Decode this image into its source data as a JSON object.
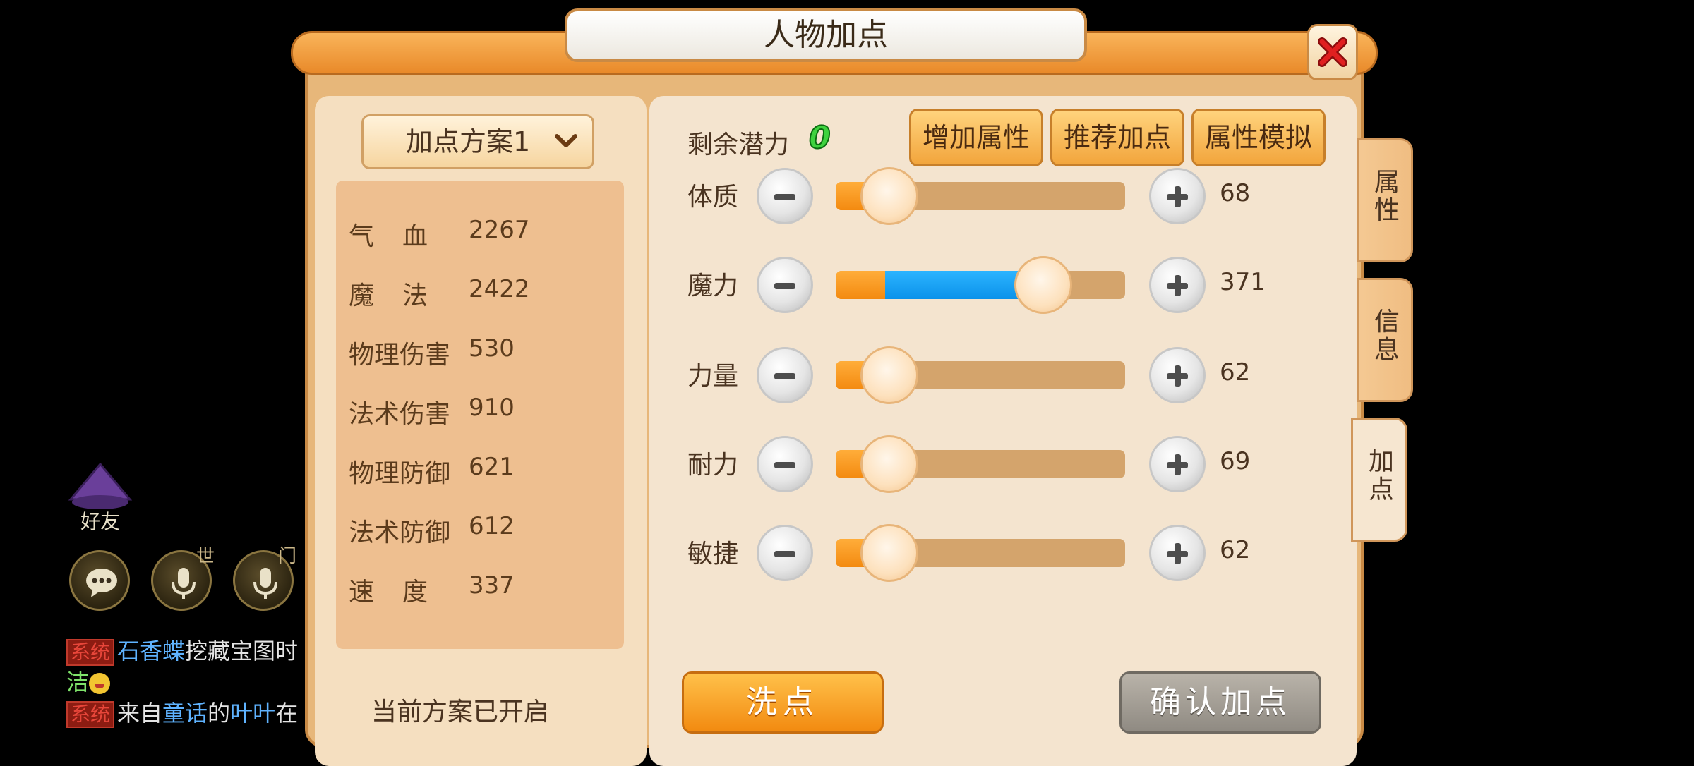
{
  "social": {
    "friend_label": "好友",
    "world_channel": "世",
    "sect_channel": "门"
  },
  "chat": {
    "line1_tag": "系统",
    "line1_name": "石香蝶",
    "line1_text": "挖藏宝图时",
    "line2_text": "洁",
    "line3_tag": "系统",
    "line3_prefix": "来自",
    "line3_place": "童话",
    "line3_mid": "的",
    "line3_name": "叶叶",
    "line3_suffix": "在"
  },
  "dialog": {
    "title": "人物加点",
    "plan_dropdown": "加点方案1",
    "plan_status": "当前方案已开启",
    "stats": [
      {
        "name": "气血",
        "value": "2267"
      },
      {
        "name": "魔法",
        "value": "2422"
      },
      {
        "name": "物理伤害",
        "value": "530"
      },
      {
        "name": "法术伤害",
        "value": "910"
      },
      {
        "name": "物理防御",
        "value": "621"
      },
      {
        "name": "法术防御",
        "value": "612"
      },
      {
        "name": "速度",
        "value": "337"
      }
    ],
    "potential_label": "剩余潜力",
    "potential_value": "0",
    "buttons": {
      "add_attr": "增加属性",
      "recommend": "推荐加点",
      "simulate": "属性模拟",
      "wash": "洗点",
      "confirm": "确认加点"
    },
    "attributes": [
      {
        "name": "体质",
        "value": "68",
        "fill": 0.0
      },
      {
        "name": "魔力",
        "value": "371",
        "fill": 0.73
      },
      {
        "name": "力量",
        "value": "62",
        "fill": 0.0
      },
      {
        "name": "耐力",
        "value": "69",
        "fill": 0.0
      },
      {
        "name": "敏捷",
        "value": "62",
        "fill": 0.0
      }
    ],
    "side_tabs": [
      {
        "label": "属性",
        "active": false
      },
      {
        "label": "信息",
        "active": false
      },
      {
        "label": "加点",
        "active": true
      }
    ]
  },
  "colors": {
    "accent_orange": "#f28a10",
    "slider_blue": "#0b92ea",
    "potential_green": "#3fd23f",
    "close_red": "#e02020"
  }
}
